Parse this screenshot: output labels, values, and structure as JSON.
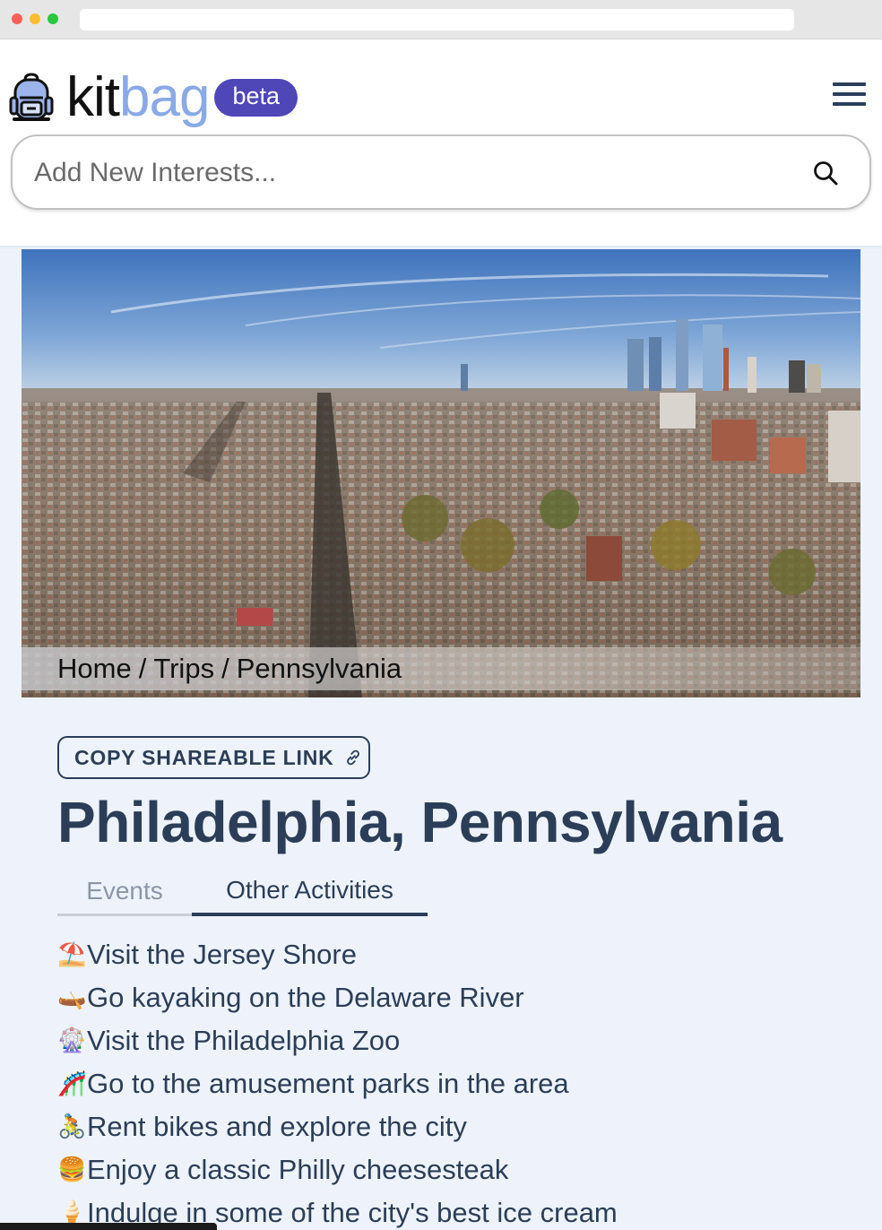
{
  "header": {
    "logo_part1": "kit",
    "logo_part2": "bag",
    "badge": "beta"
  },
  "search": {
    "placeholder": "Add New Interests..."
  },
  "breadcrumb": {
    "items": [
      "Home",
      "Trips",
      "Pennsylvania"
    ],
    "separator": "/"
  },
  "share": {
    "label": "COPY SHAREABLE LINK"
  },
  "page": {
    "title": "Philadelphia, Pennsylvania"
  },
  "tabs": [
    {
      "label": "Events",
      "active": false
    },
    {
      "label": "Other Activities",
      "active": true
    }
  ],
  "activities": [
    {
      "emoji": "⛱️",
      "text": "Visit the Jersey Shore"
    },
    {
      "emoji": "🛶",
      "text": "Go kayaking on the Delaware River"
    },
    {
      "emoji": "🎡",
      "text": "Visit the Philadelphia Zoo"
    },
    {
      "emoji": "🎢",
      "text": "Go to the amusement parks in the area"
    },
    {
      "emoji": "🚴",
      "text": "Rent bikes and explore the city"
    },
    {
      "emoji": "🍔",
      "text": "Enjoy a classic Philly cheesesteak"
    },
    {
      "emoji": "🍦",
      "text": "Indulge in some of the city's best ice cream"
    }
  ],
  "colors": {
    "brand_dark": "#2c3e57",
    "brand_light": "#8aa9e6",
    "badge": "#4f46b8",
    "page_bg": "#eef3fb"
  }
}
